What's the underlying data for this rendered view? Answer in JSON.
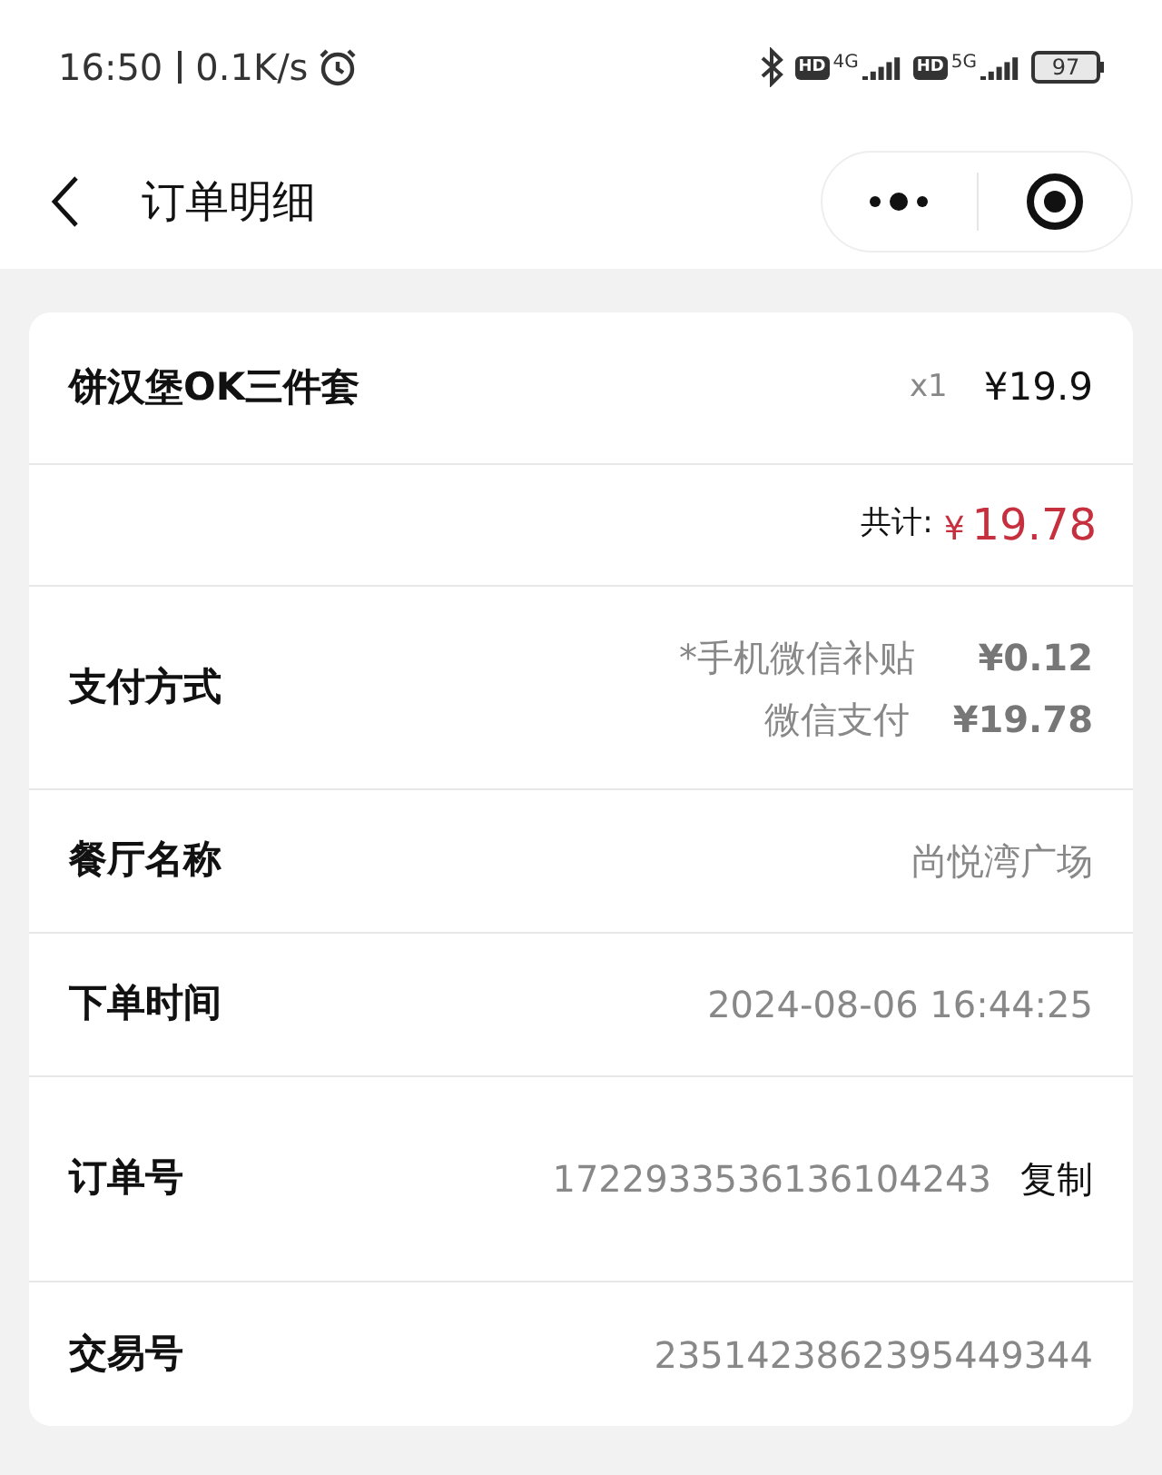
{
  "status_bar": {
    "time": "16:50",
    "speed": "0.1K/s",
    "sim1": {
      "hd": "HD",
      "network": "4G"
    },
    "sim2": {
      "hd": "HD",
      "network": "5G"
    },
    "battery": "97"
  },
  "header": {
    "title": "订单明细"
  },
  "item": {
    "name": "饼汉堡OK三件套",
    "quantity": "x1",
    "price": "¥19.9"
  },
  "total": {
    "label": "共计:",
    "currency": "¥",
    "amount": "19.78"
  },
  "payment": {
    "label": "支付方式",
    "lines": [
      {
        "name": "*手机微信补贴",
        "amount": "¥0.12"
      },
      {
        "name": "微信支付",
        "amount": "¥19.78"
      }
    ]
  },
  "fields": [
    {
      "label": "餐厅名称",
      "value": "尚悦湾广场"
    },
    {
      "label": "下单时间",
      "value": "2024-08-06 16:44:25"
    },
    {
      "label": "订单号",
      "value": "1722933536136104243",
      "action": "复制"
    },
    {
      "label": "交易号",
      "value": "2351423862395449344"
    }
  ]
}
